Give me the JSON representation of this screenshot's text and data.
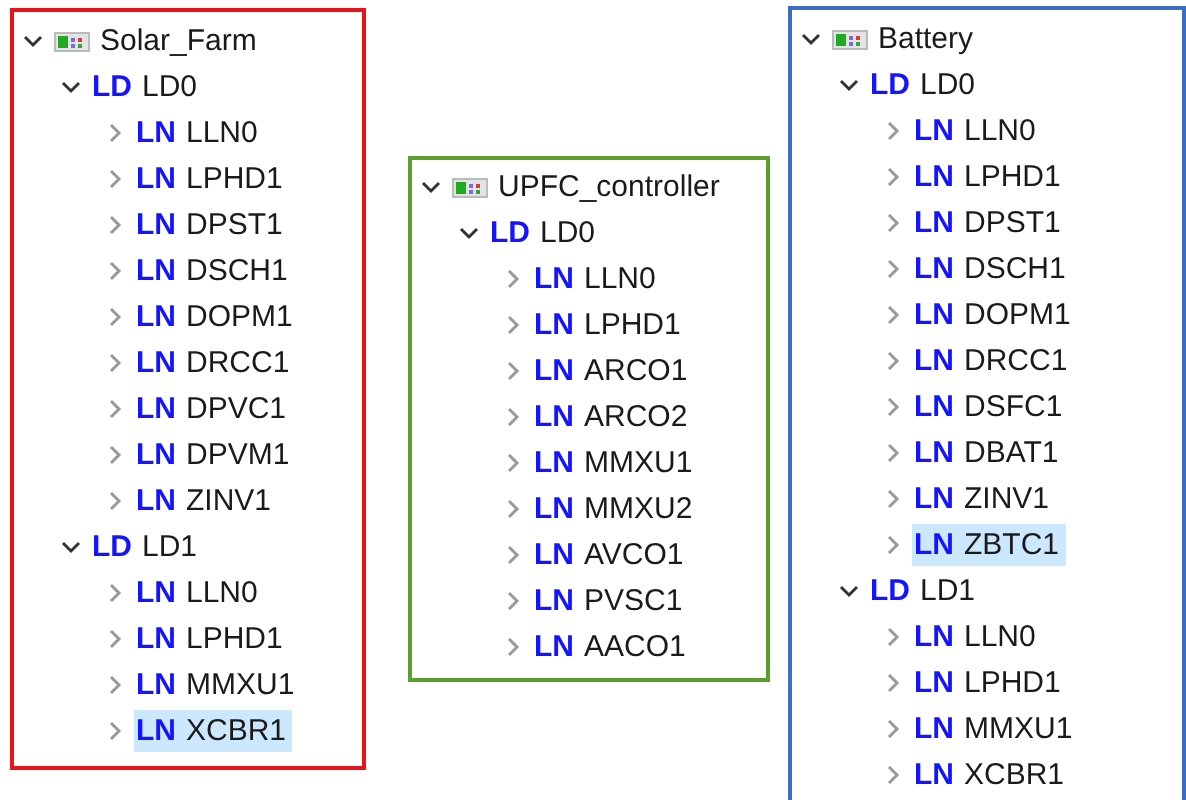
{
  "panels": [
    {
      "color": "#e8141c",
      "root": {
        "label": "Solar_Farm",
        "expanded": true,
        "children": [
          {
            "tag": "LD",
            "label": "LD0",
            "expanded": true,
            "children": [
              {
                "tag": "LN",
                "label": "LLN0",
                "expanded": false,
                "selected": false
              },
              {
                "tag": "LN",
                "label": "LPHD1",
                "expanded": false,
                "selected": false
              },
              {
                "tag": "LN",
                "label": "DPST1",
                "expanded": false,
                "selected": false
              },
              {
                "tag": "LN",
                "label": "DSCH1",
                "expanded": false,
                "selected": false
              },
              {
                "tag": "LN",
                "label": "DOPM1",
                "expanded": false,
                "selected": false
              },
              {
                "tag": "LN",
                "label": "DRCC1",
                "expanded": false,
                "selected": false
              },
              {
                "tag": "LN",
                "label": "DPVC1",
                "expanded": false,
                "selected": false
              },
              {
                "tag": "LN",
                "label": "DPVM1",
                "expanded": false,
                "selected": false
              },
              {
                "tag": "LN",
                "label": "ZINV1",
                "expanded": false,
                "selected": false
              }
            ]
          },
          {
            "tag": "LD",
            "label": "LD1",
            "expanded": true,
            "children": [
              {
                "tag": "LN",
                "label": "LLN0",
                "expanded": false,
                "selected": false
              },
              {
                "tag": "LN",
                "label": "LPHD1",
                "expanded": false,
                "selected": false
              },
              {
                "tag": "LN",
                "label": "MMXU1",
                "expanded": false,
                "selected": false
              },
              {
                "tag": "LN",
                "label": "XCBR1",
                "expanded": false,
                "selected": true
              }
            ]
          }
        ]
      }
    },
    {
      "color": "#5aa02c",
      "root": {
        "label": "UPFC_controller",
        "expanded": true,
        "children": [
          {
            "tag": "LD",
            "label": "LD0",
            "expanded": true,
            "children": [
              {
                "tag": "LN",
                "label": "LLN0",
                "expanded": false,
                "selected": false
              },
              {
                "tag": "LN",
                "label": "LPHD1",
                "expanded": false,
                "selected": false
              },
              {
                "tag": "LN",
                "label": "ARCO1",
                "expanded": false,
                "selected": false
              },
              {
                "tag": "LN",
                "label": "ARCO2",
                "expanded": false,
                "selected": false
              },
              {
                "tag": "LN",
                "label": "MMXU1",
                "expanded": false,
                "selected": false
              },
              {
                "tag": "LN",
                "label": "MMXU2",
                "expanded": false,
                "selected": false
              },
              {
                "tag": "LN",
                "label": "AVCO1",
                "expanded": false,
                "selected": false
              },
              {
                "tag": "LN",
                "label": "PVSC1",
                "expanded": false,
                "selected": false
              },
              {
                "tag": "LN",
                "label": "AACO1",
                "expanded": false,
                "selected": false
              }
            ]
          }
        ]
      }
    },
    {
      "color": "#3a6fc4",
      "root": {
        "label": "Battery",
        "expanded": true,
        "children": [
          {
            "tag": "LD",
            "label": "LD0",
            "expanded": true,
            "children": [
              {
                "tag": "LN",
                "label": "LLN0",
                "expanded": false,
                "selected": false
              },
              {
                "tag": "LN",
                "label": "LPHD1",
                "expanded": false,
                "selected": false
              },
              {
                "tag": "LN",
                "label": "DPST1",
                "expanded": false,
                "selected": false
              },
              {
                "tag": "LN",
                "label": "DSCH1",
                "expanded": false,
                "selected": false
              },
              {
                "tag": "LN",
                "label": "DOPM1",
                "expanded": false,
                "selected": false
              },
              {
                "tag": "LN",
                "label": "DRCC1",
                "expanded": false,
                "selected": false
              },
              {
                "tag": "LN",
                "label": "DSFC1",
                "expanded": false,
                "selected": false
              },
              {
                "tag": "LN",
                "label": "DBAT1",
                "expanded": false,
                "selected": false
              },
              {
                "tag": "LN",
                "label": "ZINV1",
                "expanded": false,
                "selected": false
              },
              {
                "tag": "LN",
                "label": "ZBTC1",
                "expanded": false,
                "selected": true
              }
            ]
          },
          {
            "tag": "LD",
            "label": "LD1",
            "expanded": true,
            "children": [
              {
                "tag": "LN",
                "label": "LLN0",
                "expanded": false,
                "selected": false
              },
              {
                "tag": "LN",
                "label": "LPHD1",
                "expanded": false,
                "selected": false
              },
              {
                "tag": "LN",
                "label": "MMXU1",
                "expanded": false,
                "selected": false
              },
              {
                "tag": "LN",
                "label": "XCBR1",
                "expanded": false,
                "selected": false
              }
            ]
          }
        ]
      }
    }
  ]
}
